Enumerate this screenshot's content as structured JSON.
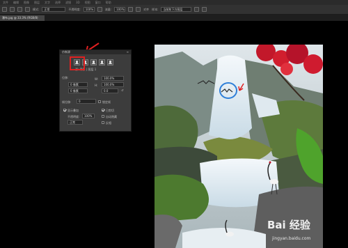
{
  "menubar": {
    "items": [
      "文件",
      "编辑",
      "图像",
      "图层",
      "文字",
      "选择",
      "滤镜",
      "3D",
      "视图",
      "窗口",
      "帮助"
    ]
  },
  "options": {
    "mode_label": "模式:",
    "mode_value": "正常",
    "opacity_label": "不透明度:",
    "opacity_value": "100%",
    "flow_label": "流量:",
    "flow_value": "100%",
    "aligned_label": "对齐",
    "sample_label": "样本:",
    "sample_value": "当前和下方图层"
  },
  "document": {
    "tab_label": "瀑布.jpg @ 33.3% (RGB/8)"
  },
  "clone_panel": {
    "title": "仿制源",
    "source_label": "源: 背景 | 图层 1",
    "offset_label": "位移:",
    "w_label": "W:",
    "w_value": "100.0%",
    "h_label": "H:",
    "h_value": "100.0%",
    "x_value": "0 像素",
    "y_value": "0 像素",
    "angle_value": "0.0",
    "frame_offset_label": "帧位移:",
    "frame_offset_value": "0",
    "lock_frame_label": "锁定帧",
    "show_overlay_label": "显示叠加",
    "opacity_label": "不透明度:",
    "opacity_value": "100%",
    "clipped_label": "已剪切",
    "auto_hide_label": "自动隐藏",
    "invert_label": "反相",
    "blend_value": "正常"
  },
  "watermark": {
    "text": "Bai 经验",
    "url": "jingyan.baidu.com"
  },
  "colors": {
    "annotation": "#e02020",
    "highlight_circle": "#2f7fd8",
    "panel_bg": "#3c3c3c"
  }
}
